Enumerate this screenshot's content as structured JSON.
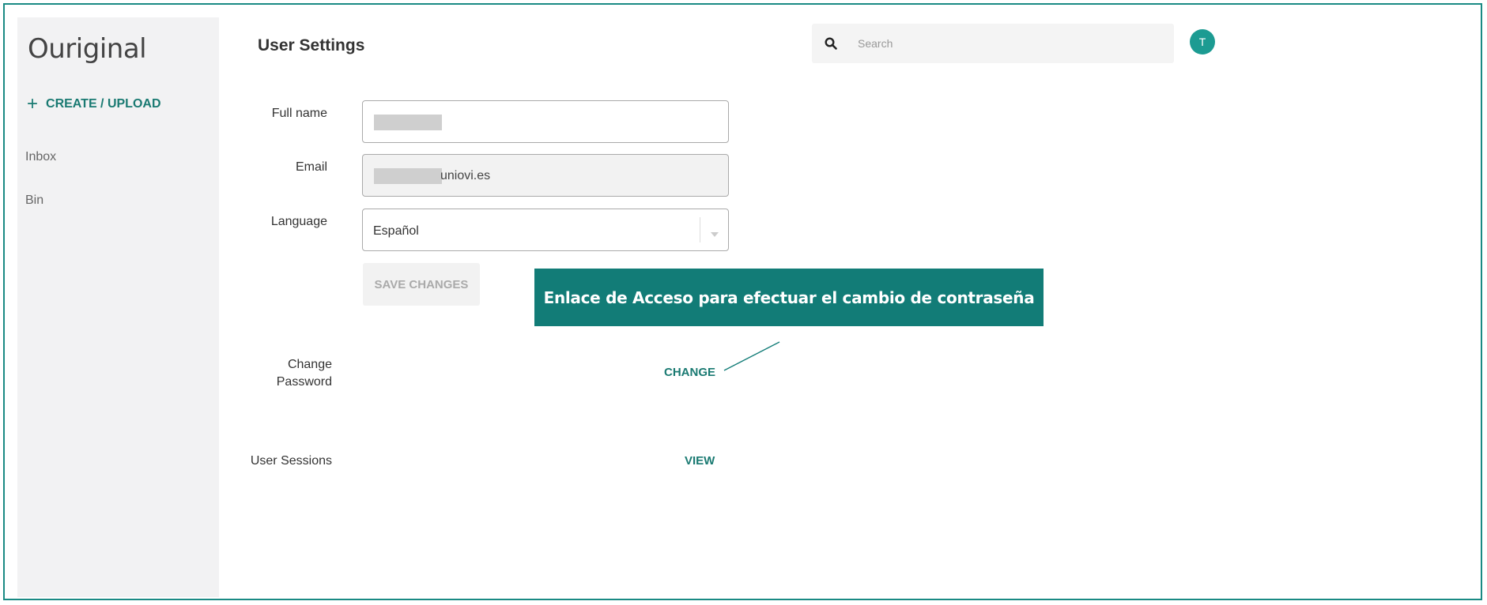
{
  "app": {
    "logo": "Ouriginal"
  },
  "sidebar": {
    "create_label": "CREATE / UPLOAD",
    "items": [
      {
        "label": "Inbox"
      },
      {
        "label": "Bin"
      }
    ]
  },
  "header": {
    "title": "User Settings",
    "search": {
      "placeholder": "Search",
      "value": ""
    },
    "avatar_initial": "T"
  },
  "form": {
    "full_name": {
      "label": "Full name",
      "value": ""
    },
    "email": {
      "label": "Email",
      "value_visible": "uniovi.es"
    },
    "language": {
      "label": "Language",
      "value": "Español"
    },
    "save_label": "SAVE CHANGES",
    "change_password": {
      "label_line1": "Change",
      "label_line2": "Password",
      "link": "CHANGE"
    },
    "user_sessions": {
      "label": "User Sessions",
      "link": "VIEW"
    }
  },
  "annotation": {
    "text": "Enlace de Acceso para efectuar el cambio de contraseña"
  },
  "colors": {
    "accent": "#1a7a72",
    "frame": "#1a8a84",
    "callout_bg": "#127c77",
    "avatar_bg": "#1c9b92"
  }
}
